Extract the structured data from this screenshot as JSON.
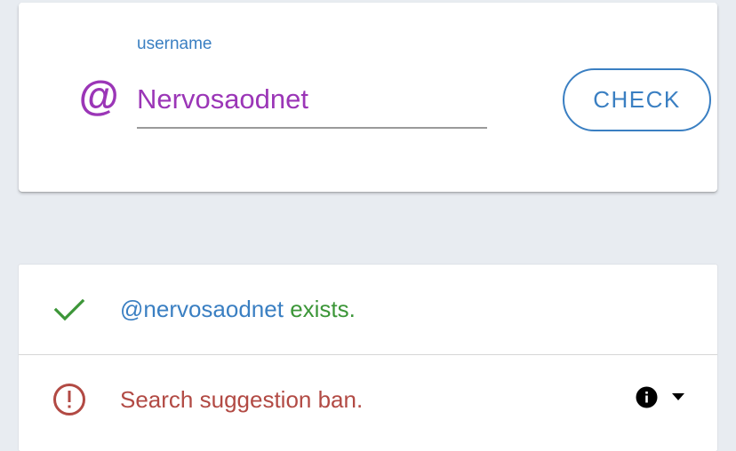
{
  "search": {
    "label": "username",
    "value": "Nervosaodnet",
    "at_symbol": "@",
    "check_label": "CHECK"
  },
  "results": [
    {
      "status": "success",
      "icon": "check-icon",
      "handle": "@nervosaodnet",
      "message": " exists."
    },
    {
      "status": "error",
      "icon": "exclamation-circle-icon",
      "message": "Search suggestion ban.",
      "extra_icons": [
        "info-icon",
        "caret-down-icon"
      ]
    }
  ],
  "colors": {
    "background": "#e8ecf1",
    "accent_blue": "#3a7fc2",
    "purple": "#9b36b7",
    "success_green": "#3c9638",
    "error_red": "#b24a44"
  }
}
